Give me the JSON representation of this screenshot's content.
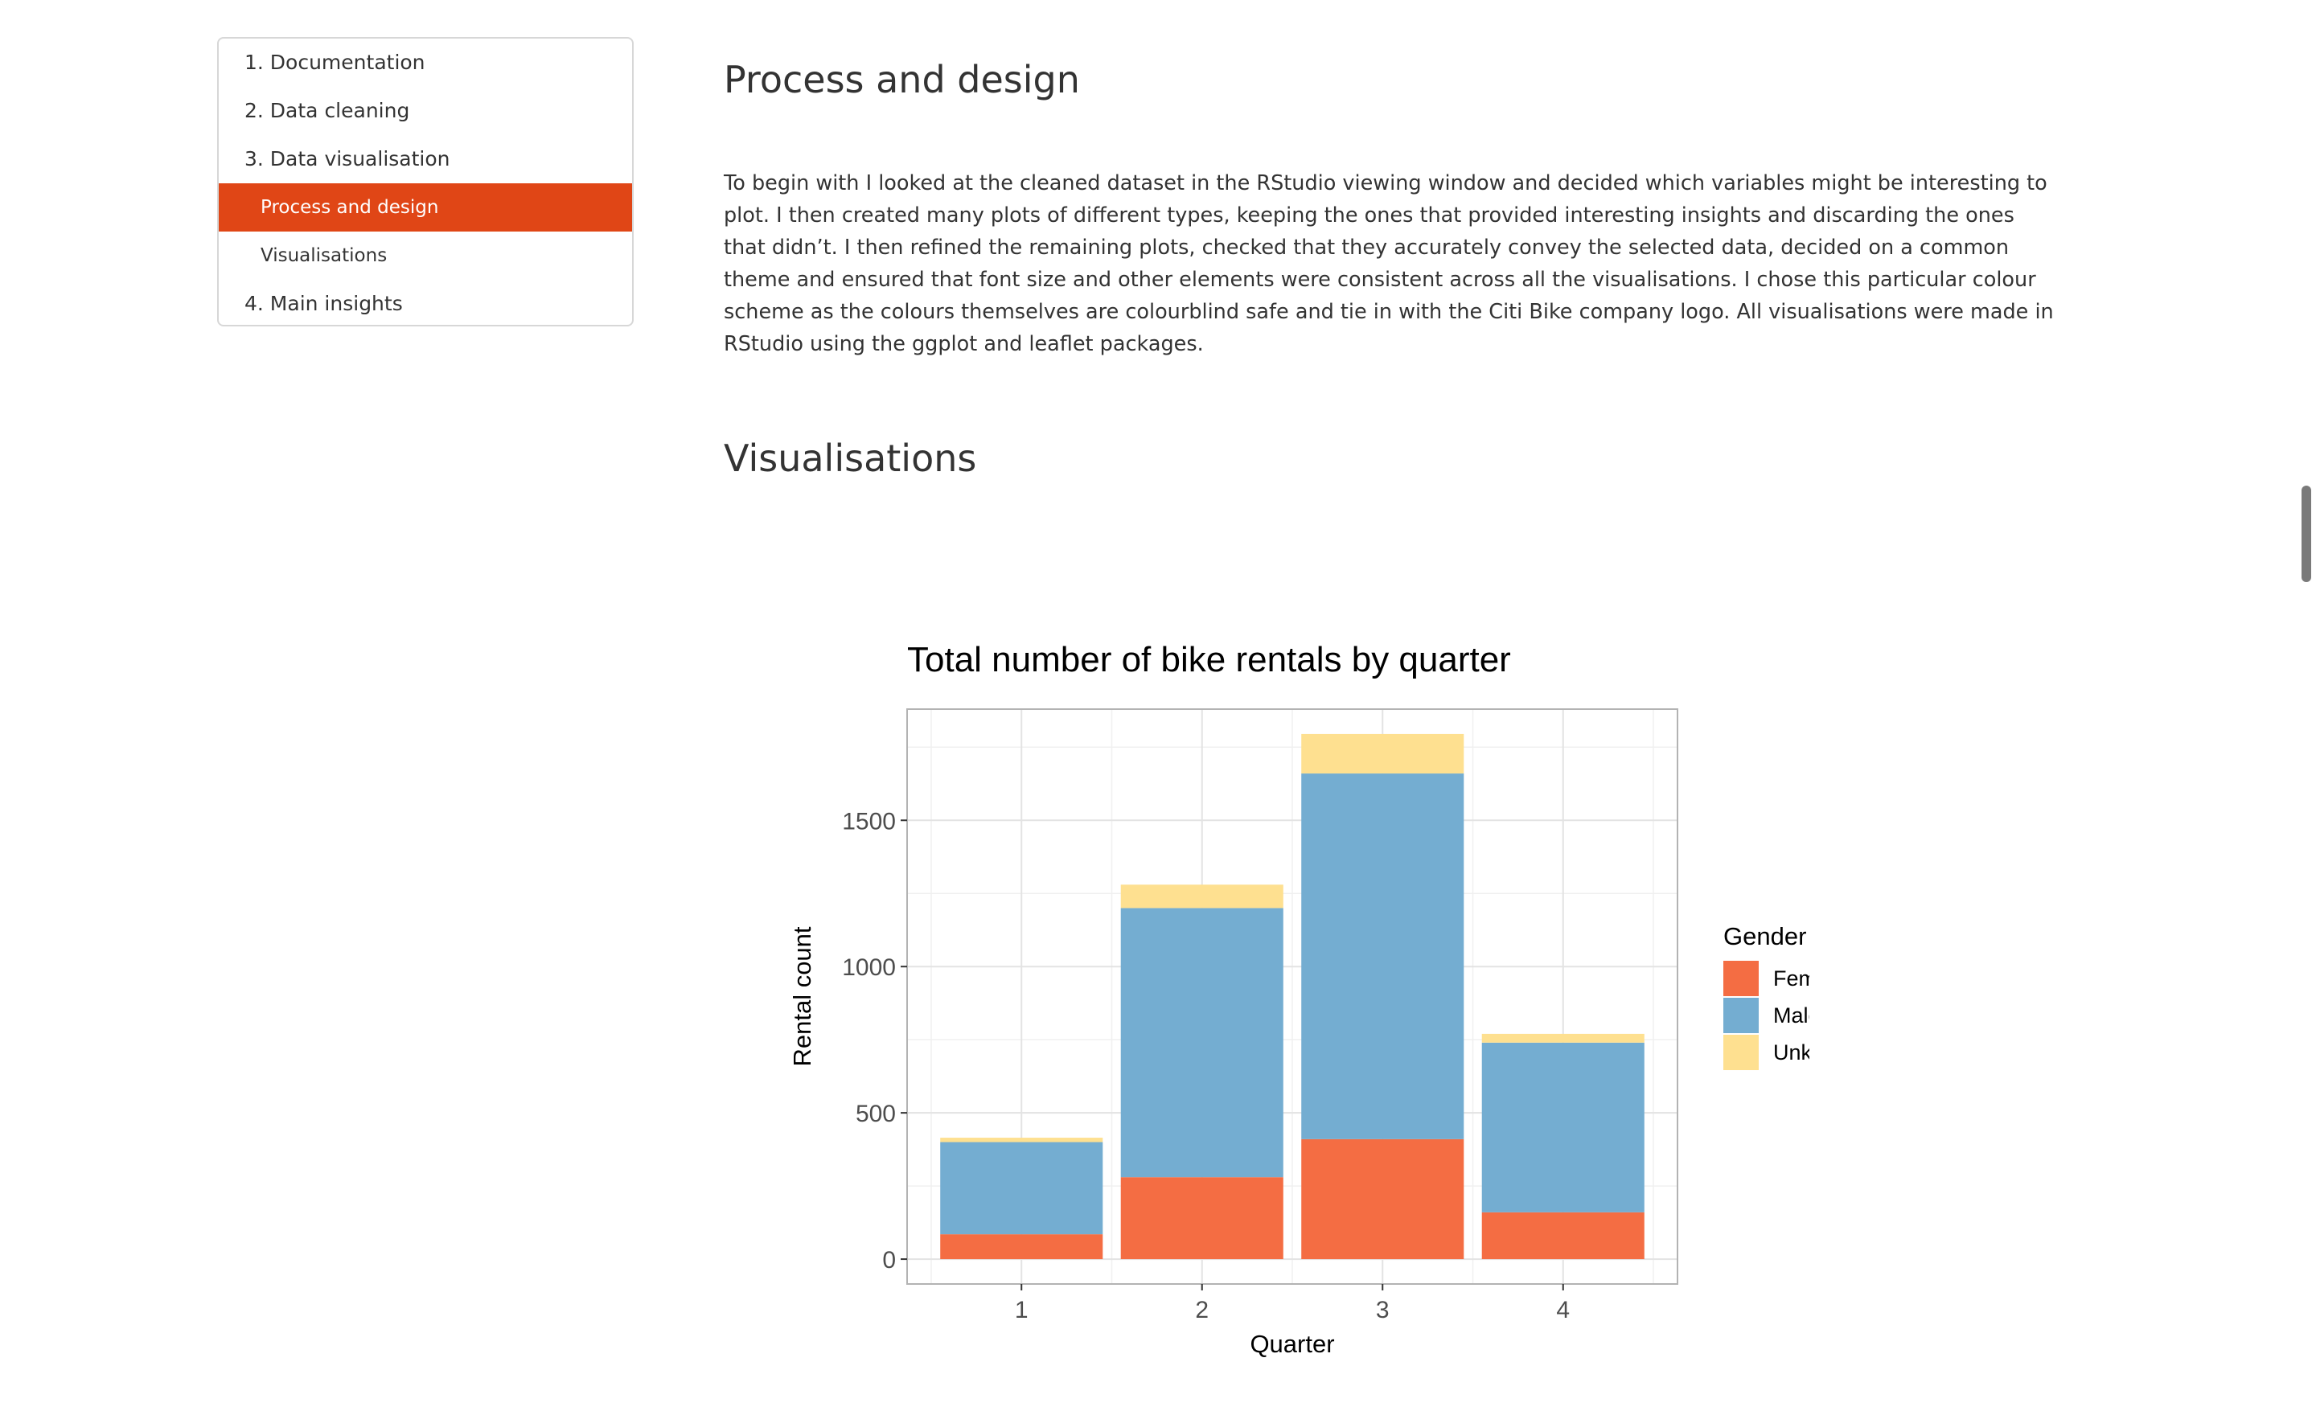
{
  "toc": {
    "items": [
      {
        "label": "1. Documentation",
        "level": 1,
        "active": false
      },
      {
        "label": "2. Data cleaning",
        "level": 1,
        "active": false
      },
      {
        "label": "3. Data visualisation",
        "level": 1,
        "active": false
      },
      {
        "label": "Process and design",
        "level": 2,
        "active": true
      },
      {
        "label": "Visualisations",
        "level": 2,
        "active": false
      },
      {
        "label": "4. Main insights",
        "level": 1,
        "active": false
      }
    ],
    "active_color": "#e04616"
  },
  "main": {
    "process_title": "Process and design",
    "process_text": "To begin with I looked at the cleaned dataset in the RStudio viewing window and decided which variables might be interesting to plot. I then created many plots of different types, keeping the ones that provided interesting insights and discarding the ones that didn’t. I then refined the remaining plots, checked that they accurately convey the selected data, decided on a common theme and ensured that font size and other elements were consistent across all the visualisations. I chose this particular colour scheme as the colours themselves are colourblind safe and tie in with the Citi Bike company logo. All visualisations were made in RStudio using the ggplot and leaflet packages.",
    "vis_title": "Visualisations"
  },
  "chart_data": {
    "type": "bar",
    "stacked": true,
    "title": "Total number of bike rentals by quarter",
    "xlabel": "Quarter",
    "ylabel": "Rental count",
    "categories": [
      "1",
      "2",
      "3",
      "4"
    ],
    "series": [
      {
        "name": "Female",
        "color": "#f46d43",
        "values": [
          85,
          280,
          410,
          160
        ]
      },
      {
        "name": "Male",
        "color": "#74add1",
        "values": [
          315,
          920,
          1250,
          580
        ]
      },
      {
        "name": "Unknown",
        "color": "#fee090",
        "values": [
          15,
          80,
          135,
          30
        ]
      }
    ],
    "yticks": [
      0,
      500,
      1000,
      1500
    ],
    "ylim": [
      -85,
      1880
    ],
    "grid": true,
    "legend": {
      "title": "Gender",
      "position": "right"
    }
  }
}
